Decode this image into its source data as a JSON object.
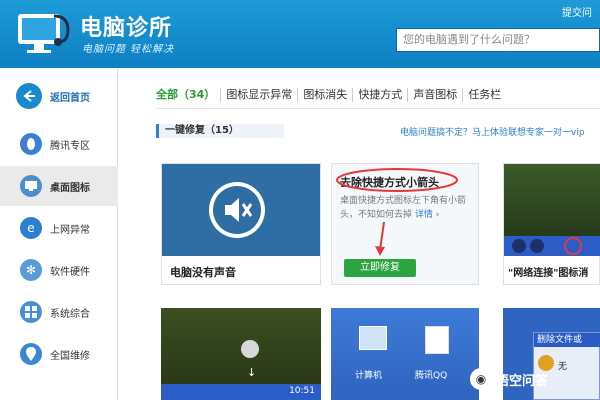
{
  "header": {
    "brand": "电脑诊所",
    "slogan": "电脑问题 轻松解决",
    "search_placeholder": "您的电脑遇到了什么问题？",
    "ask_label": "提交问"
  },
  "sidebar": {
    "items": [
      {
        "label": "返回首页",
        "icon": "back-arrow-icon",
        "color": "#1a8ad0"
      },
      {
        "label": "腾讯专区",
        "icon": "tencent-penguin-icon",
        "color": "#3a7fd0"
      },
      {
        "label": "桌面图标",
        "icon": "desktop-icon",
        "color": "#4a8fd0"
      },
      {
        "label": "上网异常",
        "icon": "ie-browser-icon",
        "color": "#2a7fd1"
      },
      {
        "label": "软件硬件",
        "icon": "gear-icon",
        "color": "#5a9ad8"
      },
      {
        "label": "系统综合",
        "icon": "windows-icon",
        "color": "#4a90d8"
      },
      {
        "label": "全国维修",
        "icon": "location-pin-icon",
        "color": "#3a88d0"
      }
    ]
  },
  "tabs": [
    {
      "label": "全部（34）"
    },
    {
      "label": "图标显示异常"
    },
    {
      "label": "图标消失"
    },
    {
      "label": "快捷方式"
    },
    {
      "label": "声音图标"
    },
    {
      "label": "任务栏"
    }
  ],
  "section": {
    "title": "一键修复（15）",
    "help_text": "电脑问题搞不定？马上体验联想专家一对一vip"
  },
  "cards": {
    "sound": {
      "caption": "电脑没有声音"
    },
    "shortcut": {
      "title": "去除快捷方式小箭头",
      "desc": "桌面快捷方式图标左下角有小箭头，不知如何去掉",
      "link": "详情",
      "link_suffix": "›",
      "button": "立即修复"
    },
    "network": {
      "caption": "\"网络连接\"图标消"
    },
    "tray": {
      "time": "10:51"
    },
    "desktop": {
      "icon1": "计算机",
      "icon2": "腾讯QQ"
    },
    "dialog": {
      "title": "删除文件或",
      "body": "无"
    }
  },
  "watermark": {
    "text": "悟空问答"
  },
  "colors": {
    "header": "#1a8ad0",
    "accent_green": "#2ca541",
    "link_blue": "#2a7fd1",
    "annotation_red": "#e23b3b"
  }
}
